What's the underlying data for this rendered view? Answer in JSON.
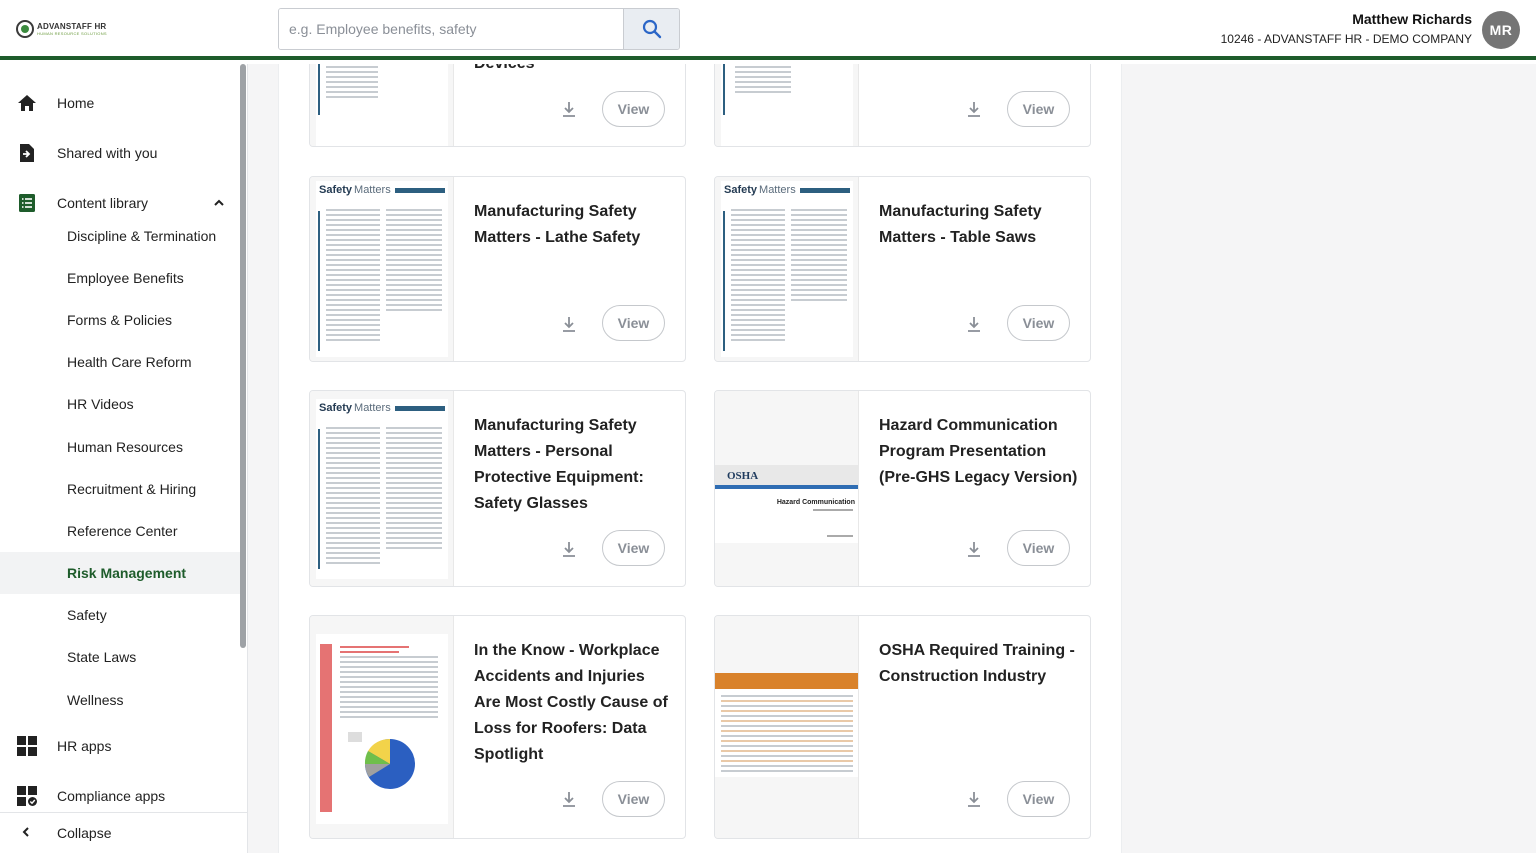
{
  "header": {
    "logo_text": "ADVANSTAFF HR",
    "logo_subtext": "HUMAN RESOURCE SOLUTIONS",
    "search_placeholder": "e.g. Employee benefits, safety",
    "user_name": "Matthew Richards",
    "company": "10246 - ADVANSTAFF HR - DEMO COMPANY",
    "avatar_initials": "MR"
  },
  "sidebar": {
    "home": "Home",
    "shared": "Shared with you",
    "content_library": "Content library",
    "sub_items": [
      "Discipline & Termination",
      "Employee Benefits",
      "Forms & Policies",
      "Health Care Reform",
      "HR Videos",
      "Human Resources",
      "Recruitment & Hiring",
      "Reference Center",
      "Risk Management",
      "Safety",
      "State Laws",
      "Wellness"
    ],
    "active_item": "Risk Management",
    "hr_apps": "HR apps",
    "compliance_apps": "Compliance apps",
    "collapse": "Collapse"
  },
  "cards": [
    {
      "title": "Devices",
      "view_label": "View"
    },
    {
      "title": "",
      "view_label": "View"
    },
    {
      "title": "Manufacturing Safety Matters - Lathe Safety",
      "view_label": "View"
    },
    {
      "title": "Manufacturing Safety Matters - Table Saws",
      "view_label": "View"
    },
    {
      "title": "Manufacturing Safety Matters - Personal Protective Equipment: Safety Glasses",
      "view_label": "View"
    },
    {
      "title": "Hazard Communication Program Presentation (Pre-GHS Legacy Version)",
      "view_label": "View"
    },
    {
      "title": "In the Know - Workplace Accidents and Injuries Are Most Costly Cause of Loss for Roofers: Data Spotlight",
      "view_label": "View"
    },
    {
      "title": "OSHA Required Training - Construction Industry",
      "view_label": "View"
    }
  ],
  "thumbs": {
    "safety_matters_brand": "Safety",
    "safety_matters_word": "Matters",
    "osha_logo": "OSHA",
    "osha_doc_title": "Hazard Communication"
  },
  "colors": {
    "brand_green": "#1e5c2b",
    "accent_blue": "#2b66c7"
  },
  "icons": {
    "search": "search-icon",
    "download": "download-icon",
    "home": "home-icon",
    "shared": "shared-document-icon",
    "library": "list-icon",
    "apps": "apps-grid-icon",
    "collapse": "chevron-left-icon"
  }
}
